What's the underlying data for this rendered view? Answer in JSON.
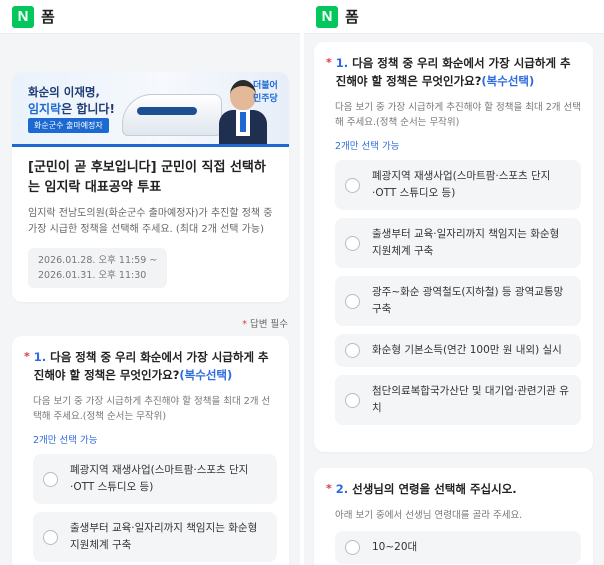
{
  "app": {
    "logo_letter": "N",
    "name": "폼"
  },
  "banner": {
    "line1": "화순의 이재명,",
    "line2_highlight": "임지락",
    "line2_rest": "은 합니다!",
    "tag": "화순군수 출마예정자",
    "party": "더불어 민주당"
  },
  "intro": {
    "title": "[군민이 곧 후보입니다] 군민이 직접 선택하는 임지락 대표공약 투표",
    "description": "임지락 전남도의원(화순군수 출마예정자)가 추진할 정책 중 가장 시급한 정책을 선택해 주세요. (최대 2개 선택 가능)",
    "date_start": "2026.01.28. 오후 11:59 ~",
    "date_end": "2026.01.31. 오후 11:30"
  },
  "required_note": {
    "star": "*",
    "label": "답변 필수"
  },
  "question1": {
    "star": "*",
    "number": "1.",
    "title": "다음 정책 중 우리 화순에서 가장 시급하게 추진해야 할 정책은 무엇인가요?",
    "title_suffix": "(복수선택)",
    "description": "다음 보기 중 가장 시급하게 추진해야 할 정책을 최대 2개 선택해 주세요.(정책 순서는 무작위)",
    "hint": "2개만 선택 가능",
    "options": [
      "폐광지역 재생사업(스마트팜·스포츠 단지·OTT 스튜디오 등)",
      "출생부터 교육·일자리까지 책임지는 화순형 지원체계 구축",
      "광주~화순 광역철도(지하철) 등 광역교통망 구축",
      "화순형 기본소득(연간 100만 원 내외) 실시",
      "첨단의료복합국가산단 및 대기업·관련기관 유치"
    ]
  },
  "question2": {
    "star": "*",
    "number": "2.",
    "title": "선생님의 연령을 선택해 주십시오.",
    "description": "아래 보기 중에서 선생님 연령대를 골라 주세요.",
    "options": [
      "10~20대"
    ]
  }
}
